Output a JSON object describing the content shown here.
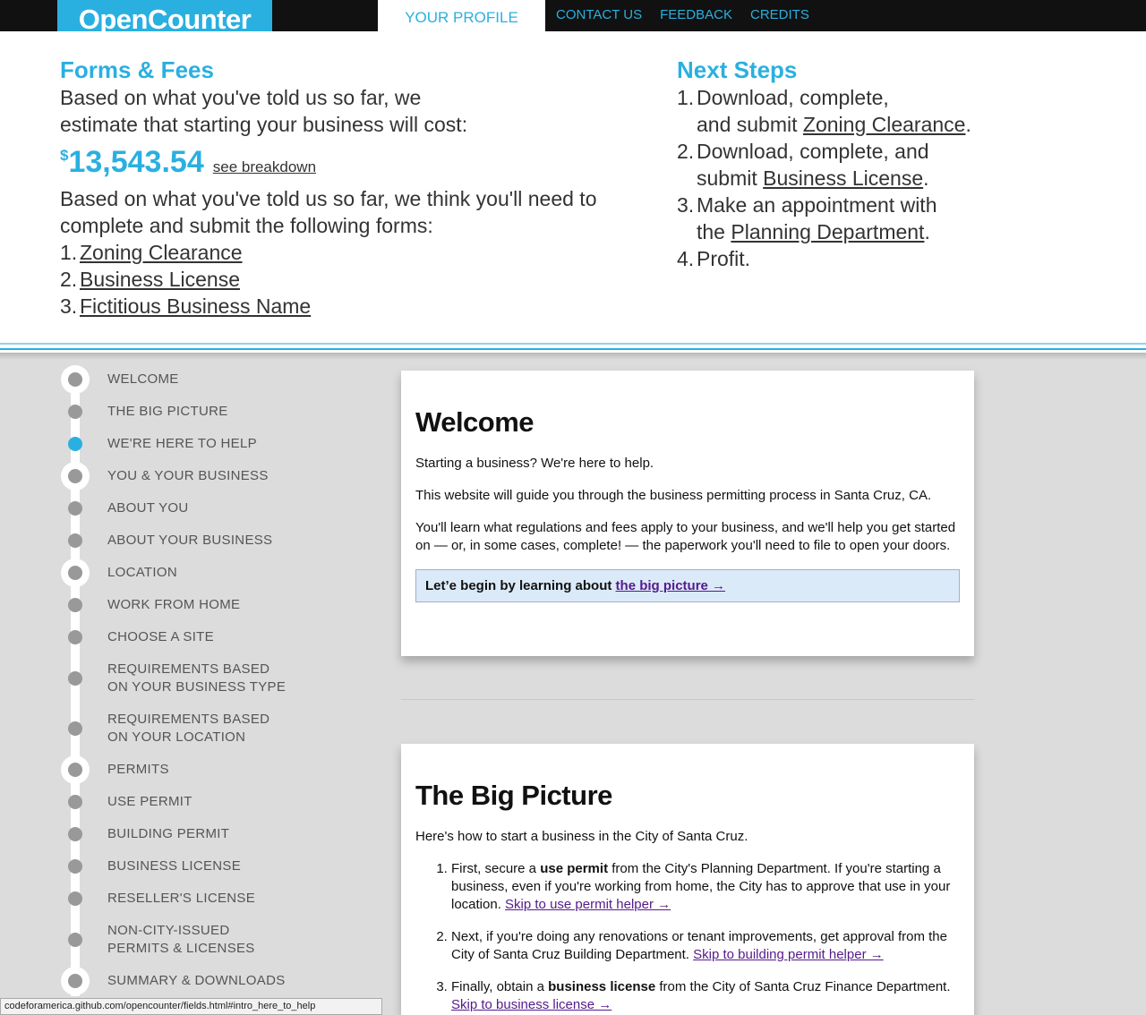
{
  "header": {
    "logo": "OpenCounter",
    "profile_tab": "YOUR PROFILE",
    "nav": [
      "CONTACT US",
      "FEEDBACK",
      "CREDITS"
    ]
  },
  "profile": {
    "forms_title": "Forms & Fees",
    "cost_intro_1": "Based on what you've told us so far, we",
    "cost_intro_2": "estimate that starting your business will cost:",
    "dollar": "$",
    "amount": "13,543.54",
    "breakdown_link": "see breakdown",
    "forms_intro_1": "Based on what you've told us so far, we think you'll need to",
    "forms_intro_2": "complete and submit the following forms:",
    "forms": [
      {
        "num": "1.",
        "label": "Zoning Clearance"
      },
      {
        "num": "2.",
        "label": "Business License"
      },
      {
        "num": "3.",
        "label": "Fictitious Business Name"
      }
    ],
    "next_title": "Next Steps",
    "steps": [
      {
        "num": "1.",
        "l1": "Download, complete,",
        "pre": "and submit ",
        "link": "Zoning Clearance",
        "post": "."
      },
      {
        "num": "2.",
        "l1": "Download, complete, and",
        "pre": "submit ",
        "link": "Business License",
        "post": "."
      },
      {
        "num": "3.",
        "l1": "Make an appointment with",
        "pre": "the ",
        "link": "Planning Department",
        "post": "."
      },
      {
        "num": "4.",
        "l1": "Profit.",
        "pre": "",
        "link": "",
        "post": ""
      }
    ]
  },
  "sidebar": {
    "items": [
      "WELCOME",
      "THE BIG PICTURE",
      "WE'RE HERE TO HELP",
      "YOU & YOUR BUSINESS",
      "ABOUT YOU",
      "ABOUT YOUR BUSINESS",
      "LOCATION",
      "WORK FROM HOME",
      "CHOOSE A SITE",
      "REQUIREMENTS BASED",
      "ON YOUR BUSINESS TYPE",
      "REQUIREMENTS BASED",
      "ON YOUR LOCATION",
      "PERMITS",
      "USE PERMIT",
      "BUILDING PERMIT",
      "BUSINESS LICENSE",
      "RESELLER'S LICENSE",
      "NON-CITY-ISSUED",
      "PERMITS & LICENSES",
      "SUMMARY & DOWNLOADS"
    ]
  },
  "welcome": {
    "title": "Welcome",
    "p1": "Starting a business? We're here to help.",
    "p2": "This website will guide you through the business permitting process in Santa Cruz, CA.",
    "p3": "You'll learn what regulations and fees apply to your business, and we'll help you get started on — or, in some cases, complete! — the paperwork you'll need to file to open your doors.",
    "callout_text": "Let’e begin by learning about ",
    "callout_link": "the big picture →"
  },
  "bigpicture": {
    "title": "The Big Picture",
    "intro": "Here's how to start a business in the City of Santa Cruz.",
    "s1_a": "First, secure a ",
    "s1_b": "use permit",
    "s1_c": " from the City's Planning Department. If you're starting a business, even if you're working from home, the City has to approve that use in your location. ",
    "s1_link": "Skip to use permit helper →",
    "s2_a": "Next, if you're doing any renovations or tenant improvements, get approval from the City of Santa Cruz Building Department. ",
    "s2_link": "Skip to building permit helper →",
    "s3_a": "Finally, obtain a ",
    "s3_b": "business license",
    "s3_c": " from the City of Santa Cruz Finance Department.",
    "s3_link": "Skip to business license →"
  },
  "status_url": "codeforamerica.github.com/opencounter/fields.html#intro_here_to_help",
  "colors": {
    "accent": "#2ab0e0",
    "callout_bg": "#dbeaf9",
    "background": "#dcdcdc"
  }
}
